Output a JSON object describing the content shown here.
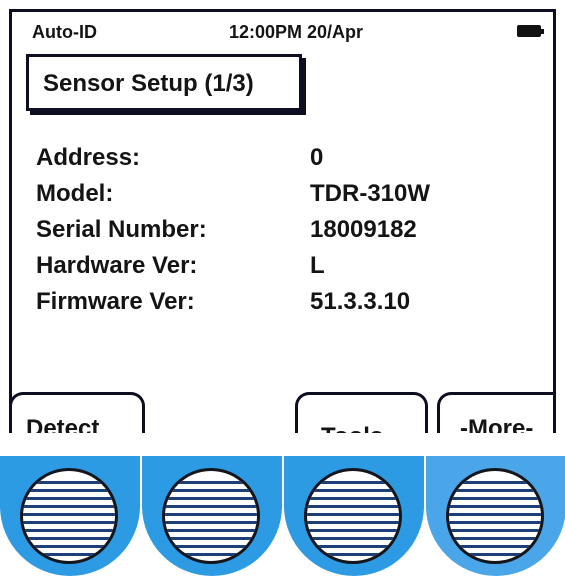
{
  "status_bar": {
    "mode": "Auto-ID",
    "datetime": "12:00PM 20/Apr",
    "battery_icon": "battery-full-icon"
  },
  "screen": {
    "title": "Sensor Setup (1/3)",
    "fields": [
      {
        "label": "Address:",
        "value": "0"
      },
      {
        "label": "Model:",
        "value": "TDR-310W"
      },
      {
        "label": "Serial Number:",
        "value": "18009182"
      },
      {
        "label": "Hardware Ver:",
        "value": "L"
      },
      {
        "label": "Firmware Ver:",
        "value": "51.3.3.10"
      }
    ]
  },
  "softkeys": {
    "key1": "Detect",
    "key3": "Tools",
    "key4": "-More-"
  },
  "hardware_buttons": {
    "color": "#2d9be4",
    "icon": "grill-icon"
  }
}
